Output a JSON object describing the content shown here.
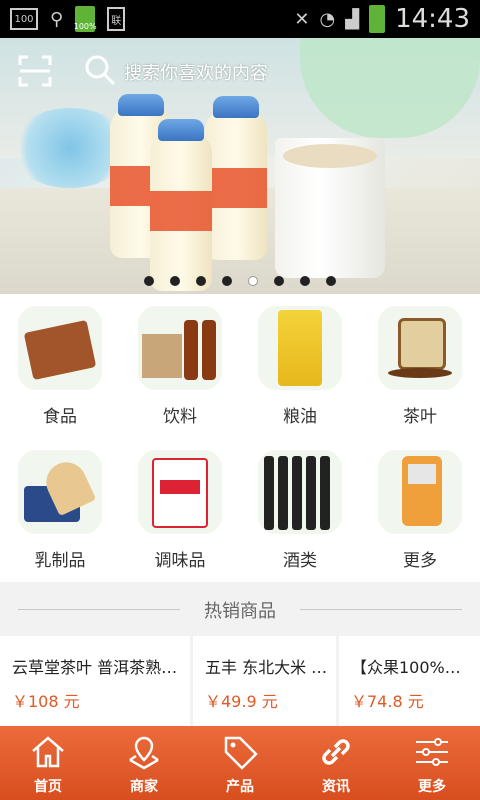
{
  "status_bar": {
    "time": "14:43",
    "battery_label": "100%",
    "box_label": "100",
    "sim_label": "联"
  },
  "search": {
    "placeholder": "搜索你喜欢的内容"
  },
  "banner": {
    "dots": 8,
    "active_dot": 5
  },
  "categories": [
    {
      "label": "食品",
      "icon": "food-thumb"
    },
    {
      "label": "饮料",
      "icon": "drink-thumb"
    },
    {
      "label": "粮油",
      "icon": "rice-thumb"
    },
    {
      "label": "茶叶",
      "icon": "tea-thumb"
    },
    {
      "label": "乳制品",
      "icon": "dairy-thumb"
    },
    {
      "label": "调味品",
      "icon": "seasoning-thumb"
    },
    {
      "label": "酒类",
      "icon": "wine-thumb"
    },
    {
      "label": "更多",
      "icon": "more-thumb"
    }
  ],
  "hot": {
    "title": "热销商品"
  },
  "products": [
    {
      "name": "云草堂茶叶 普洱茶熟…",
      "price": "￥108 元"
    },
    {
      "name": "五丰 东北大米 …",
      "price": "￥49.9 元"
    },
    {
      "name": "【众果100%纯…",
      "price": "￥74.8 元"
    }
  ],
  "tabs": [
    {
      "label": "首页",
      "icon": "home-icon"
    },
    {
      "label": "商家",
      "icon": "merchant-icon"
    },
    {
      "label": "产品",
      "icon": "sale-tag-icon"
    },
    {
      "label": "资讯",
      "icon": "link-icon"
    },
    {
      "label": "更多",
      "icon": "sliders-icon"
    }
  ],
  "colors": {
    "accent": "#e05a28",
    "tabbar": "#e2582a",
    "price": "#e05a28"
  }
}
